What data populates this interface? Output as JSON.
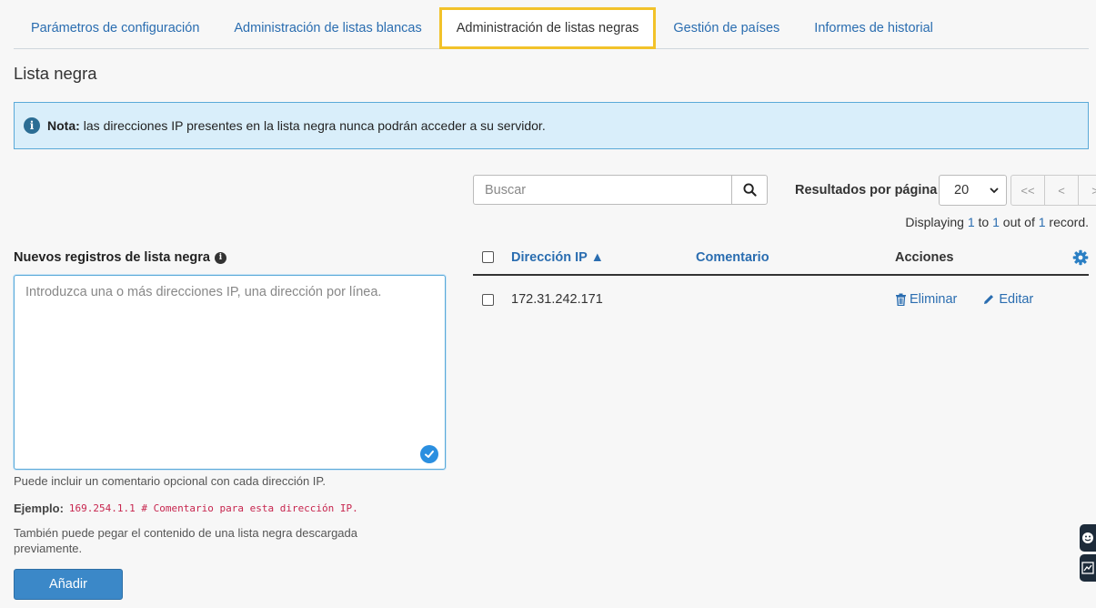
{
  "tabs": [
    {
      "label": "Parámetros de configuración"
    },
    {
      "label": "Administración de listas blancas"
    },
    {
      "label": "Administración de listas negras"
    },
    {
      "label": "Gestión de países"
    },
    {
      "label": "Informes de historial"
    }
  ],
  "page_title": "Lista negra",
  "alert": {
    "icon": "info-circle-icon",
    "bold": "Nota:",
    "text": "las direcciones IP presentes en la lista negra nunca podrán acceder a su servidor."
  },
  "form": {
    "label": "Nuevos registros de lista negra",
    "placeholder": "Introduzca una o más direcciones IP, una dirección por línea.",
    "help1": "Puede incluir un comentario opcional con cada dirección IP.",
    "example_label": "Ejemplo:",
    "example_code": "169.254.1.1 # Comentario para esta dirección IP.",
    "help2": "También puede pegar el contenido de una lista negra descargada previamente.",
    "add_button": "Añadir"
  },
  "search": {
    "placeholder": "Buscar"
  },
  "pagination": {
    "label": "Resultados por página",
    "per_page": "20",
    "first": "<<",
    "prev": "<",
    "next": ">",
    "display_prefix": "Displaying ",
    "display_from": "1",
    "display_mid": " to ",
    "display_to": "1",
    "display_mid2": " out of ",
    "display_total": "1",
    "display_suffix": " record."
  },
  "table": {
    "col_ip": "Dirección IP ▲",
    "col_comment": "Comentario",
    "col_actions": "Acciones",
    "rows": [
      {
        "ip": "172.31.242.171",
        "comment": "",
        "delete": "Eliminar",
        "edit": "Editar"
      }
    ]
  },
  "colors": {
    "accent": "#2a6db0",
    "active_tab_border": "#f2c22a",
    "alert_bg": "#d9eefa"
  }
}
